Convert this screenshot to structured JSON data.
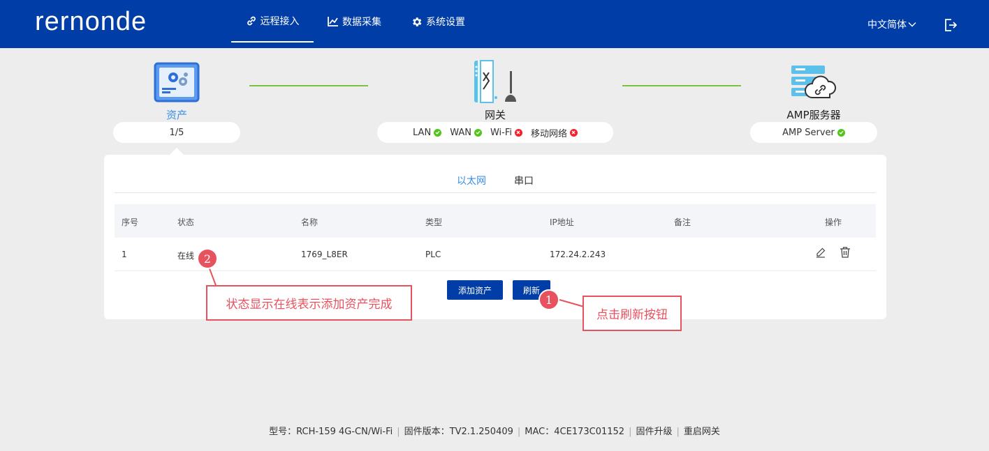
{
  "header": {
    "logo": "rernonde",
    "nav": [
      {
        "label": "远程接入",
        "icon": "link-icon",
        "active": true
      },
      {
        "label": "数据采集",
        "icon": "chart-icon",
        "active": false
      },
      {
        "label": "系统设置",
        "icon": "gear-icon",
        "active": false
      }
    ],
    "language": "中文简体"
  },
  "topology": {
    "asset": {
      "label": "资产",
      "count": "1/5"
    },
    "gateway": {
      "label": "网关",
      "status": [
        {
          "name": "LAN",
          "state": "ok"
        },
        {
          "name": "WAN",
          "state": "ok"
        },
        {
          "name": "Wi-Fi",
          "state": "error"
        },
        {
          "name": "移动网络",
          "state": "error"
        }
      ]
    },
    "server": {
      "label": "AMP服务器",
      "status_name": "AMP Server",
      "state": "ok"
    }
  },
  "tabs": [
    {
      "label": "以太网",
      "active": true
    },
    {
      "label": "串口",
      "active": false
    }
  ],
  "table": {
    "columns": [
      "序号",
      "状态",
      "名称",
      "类型",
      "IP地址",
      "备注",
      "操作"
    ],
    "rows": [
      {
        "index": "1",
        "status": "在线",
        "name": "1769_L8ER",
        "type": "PLC",
        "ip": "172.24.2.243",
        "note": ""
      }
    ]
  },
  "buttons": {
    "add_asset": "添加资产",
    "refresh": "刷新"
  },
  "annotations": [
    {
      "number": "1",
      "text": "点击刷新按钮"
    },
    {
      "number": "2",
      "text": "状态显示在线表示添加资产完成"
    }
  ],
  "footer": {
    "model": "型号：RCH-159  4G-CN/Wi-Fi",
    "firmware": "固件版本：TV2.1.250409",
    "mac": "MAC：4CE173C01152",
    "upgrade": "固件升级",
    "reboot": "重启网关"
  },
  "colors": {
    "header": "#003da6",
    "primary_button": "#003da6",
    "ok": "#52c41a",
    "error": "#f5222d",
    "annotation": "#e8525f",
    "connector": "#7cc242",
    "tab_active": "#3a8ee6"
  }
}
